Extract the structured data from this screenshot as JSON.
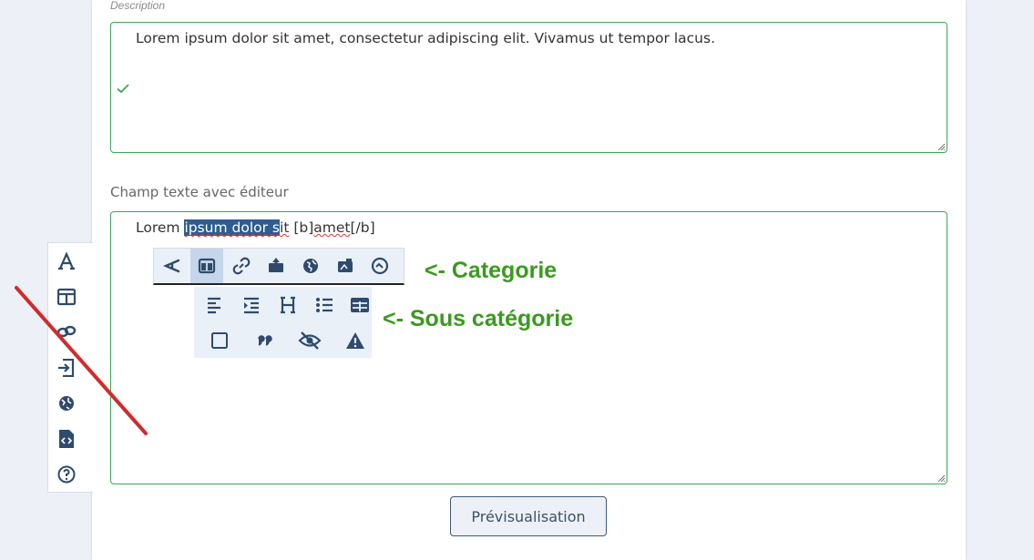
{
  "description": {
    "label": "Description",
    "value": "Lorem ipsum dolor sit amet, consectetur adipiscing elit. Vivamus ut tempor lacus."
  },
  "editor": {
    "label": "Champ texte avec éditeur",
    "text_before": "Lorem ",
    "text_selected": "ipsum dolor s",
    "text_after_1": "it",
    "text_after_2": " [b]",
    "text_after_3": "amet",
    "text_after_4": "[/b]"
  },
  "annotations": {
    "category": "<- Categorie",
    "subcategory": "<- Sous catégorie"
  },
  "toolbar": {
    "category_icons": [
      "text-style-icon",
      "layout-icon",
      "link-icon",
      "upload-icon",
      "globe-icon",
      "image-icon",
      "gauge-icon"
    ],
    "subcategory_icons": [
      "align-left-icon",
      "indent-icon",
      "heading-icon",
      "list-icon",
      "table-icon",
      "square-icon",
      "quote-icon",
      "eye-slash-icon",
      "warning-icon"
    ]
  },
  "sidebar": {
    "icons": [
      "font-icon",
      "layout-icon",
      "link-icon",
      "sign-in-icon",
      "globe-icon",
      "code-file-icon",
      "help-icon"
    ]
  },
  "preview_button": "Prévisualisation",
  "colors": {
    "accent": "#2e5d8f",
    "icon": "#2f4b6c",
    "valid_border": "#3aa757",
    "annotation": "#3a9a1f",
    "strike": "#d12b2b"
  }
}
